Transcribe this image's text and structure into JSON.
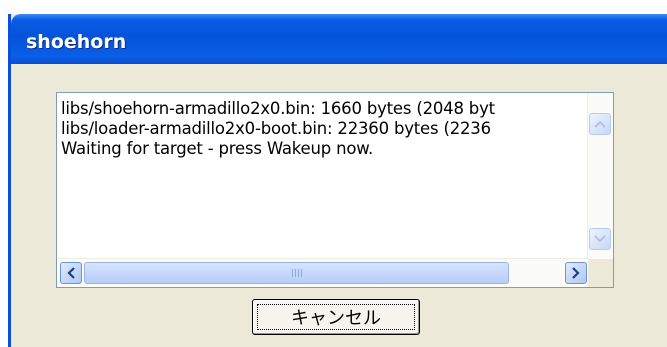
{
  "window": {
    "title": "shoehorn"
  },
  "log": {
    "lines": [
      "libs/shoehorn-armadillo2x0.bin: 1660 bytes (2048 byt",
      "libs/loader-armadillo2x0-boot.bin: 22360 bytes (2236",
      "Waiting for target - press Wakeup now."
    ]
  },
  "buttons": {
    "cancel_label": "キャンセル"
  },
  "icons": {
    "scroll_up": "chevron-up-icon",
    "scroll_down": "chevron-down-icon",
    "scroll_left": "chevron-left-icon",
    "scroll_right": "chevron-right-icon"
  },
  "colors": {
    "titlebar": "#0553d8",
    "dialog_bg": "#ece9d8"
  }
}
